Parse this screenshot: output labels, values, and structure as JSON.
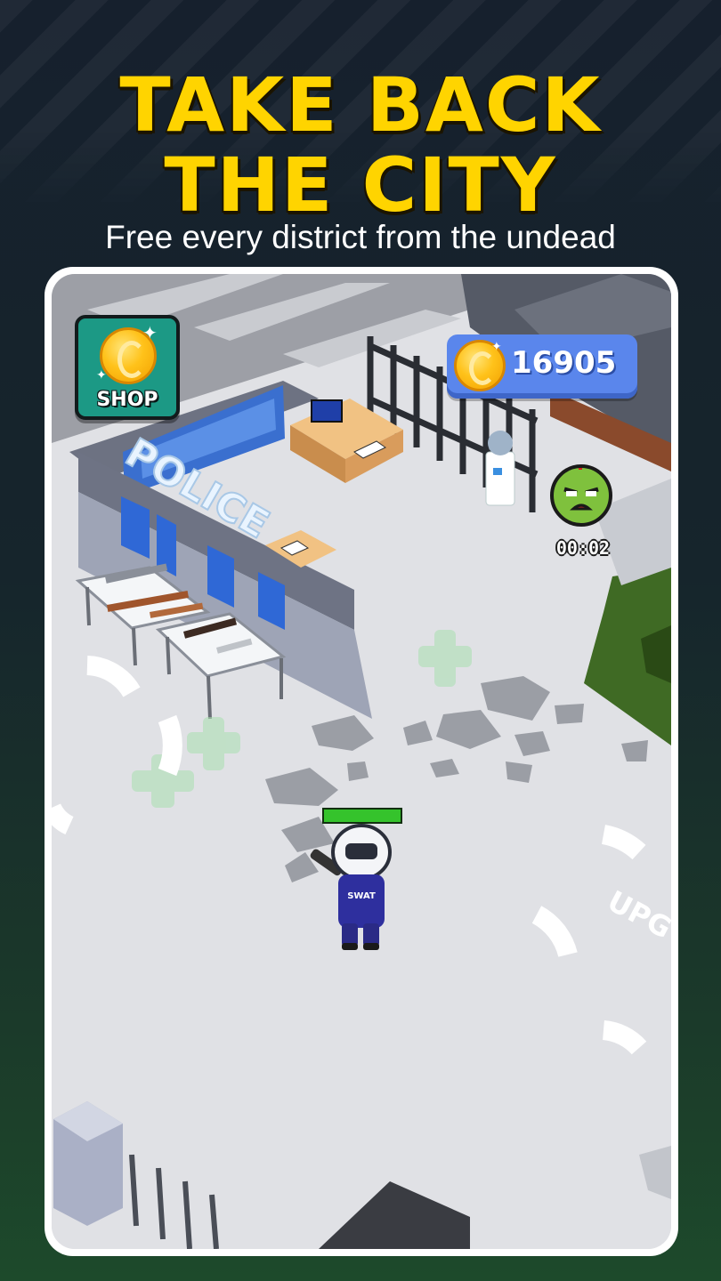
{
  "promo": {
    "headline_line1": "TAKE BACK",
    "headline_line2": "THE CITY",
    "subtitle": "Free every district from the undead",
    "headline_color": "#ffd400"
  },
  "hud": {
    "shop_label": "SHOP",
    "shop_icon": "gold-coin-icon",
    "coins": "16905",
    "coin_icon": "gold-coin-icon",
    "zombie_icon": "zombie-face-icon",
    "zombie_timer": "00:02",
    "player_health": 1.0
  },
  "scene": {
    "police_sign": "POLICE",
    "floor_text": "UPG",
    "player_vest": "SWAT"
  },
  "colors": {
    "background_top": "#16202d",
    "background_bottom": "#1d4a2b",
    "shop_button": "#1c9985",
    "coin_pill": "#5a86ec",
    "health": "#35c32c",
    "zombie": "#7fc13d"
  }
}
